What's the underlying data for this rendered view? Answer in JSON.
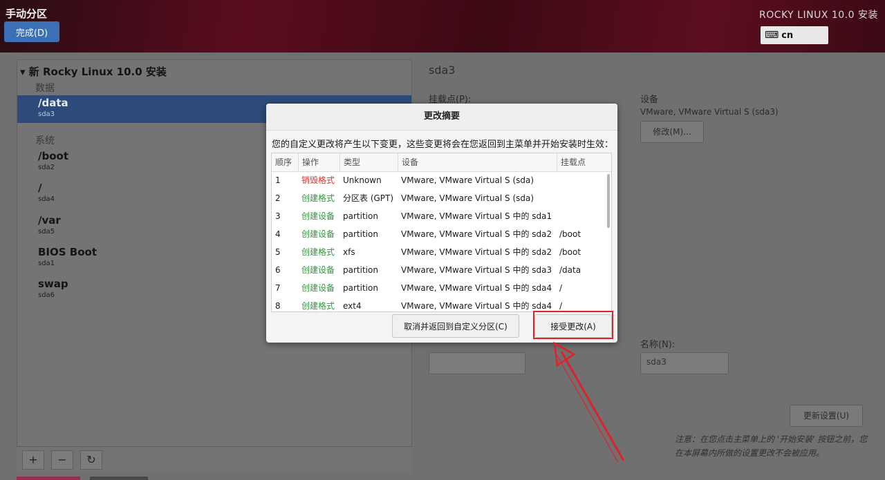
{
  "topbar": {
    "title": "手动分区",
    "done_label": "完成(D)",
    "product": "ROCKY LINUX 10.0 安装",
    "keyboard_layout": "cn"
  },
  "tree": {
    "header": "新 Rocky Linux 10.0 安装",
    "groups": [
      "数据",
      "系统"
    ],
    "partitions": [
      {
        "mount": "/data",
        "device": "sda3",
        "selected": true
      },
      {
        "mount": "/boot",
        "device": "sda2"
      },
      {
        "mount": "/",
        "device": "sda4"
      },
      {
        "mount": "/var",
        "device": "sda5"
      },
      {
        "mount": "BIOS Boot",
        "device": "sda1"
      },
      {
        "mount": "swap",
        "device": "sda6"
      }
    ],
    "tools": [
      "+",
      "−",
      "↻"
    ]
  },
  "details": {
    "title": "sda3",
    "mount_label": "挂载点(P):",
    "device_label": "设备",
    "device_value": "VMware, VMware Virtual S (sda3)",
    "modify_label": "修改(M)...",
    "name_label": "名称(N):",
    "name_value": "sda3",
    "update_label": "更新设置(U)",
    "note": "注意：在您点击主菜单上的 '开始安装' 按钮之前，您在本屏幕内所做的设置更改不会被应用。"
  },
  "dialog": {
    "title": "更改摘要",
    "description": "您的自定义更改将产生以下变更，这些变更将会在您返回到主菜单并开始安装时生效：",
    "columns": [
      "顺序",
      "操作",
      "类型",
      "设备",
      "挂载点"
    ],
    "rows": [
      {
        "order": "1",
        "action": "销毁格式",
        "action_color": "red",
        "type": "Unknown",
        "device": "VMware, VMware Virtual S (sda)",
        "mount": ""
      },
      {
        "order": "2",
        "action": "创建格式",
        "action_color": "green",
        "type": "分区表 (GPT)",
        "device": "VMware, VMware Virtual S (sda)",
        "mount": ""
      },
      {
        "order": "3",
        "action": "创建设备",
        "action_color": "green",
        "type": "partition",
        "device": "VMware, VMware Virtual S 中的 sda1",
        "mount": ""
      },
      {
        "order": "4",
        "action": "创建设备",
        "action_color": "green",
        "type": "partition",
        "device": "VMware, VMware Virtual S 中的 sda2",
        "mount": "/boot"
      },
      {
        "order": "5",
        "action": "创建格式",
        "action_color": "green",
        "type": "xfs",
        "device": "VMware, VMware Virtual S 中的 sda2",
        "mount": "/boot"
      },
      {
        "order": "6",
        "action": "创建设备",
        "action_color": "green",
        "type": "partition",
        "device": "VMware, VMware Virtual S 中的 sda3",
        "mount": "/data"
      },
      {
        "order": "7",
        "action": "创建设备",
        "action_color": "green",
        "type": "partition",
        "device": "VMware, VMware Virtual S 中的 sda4",
        "mount": "/"
      },
      {
        "order": "8",
        "action": "创建格式",
        "action_color": "green",
        "type": "ext4",
        "device": "VMware, VMware Virtual S 中的 sda4",
        "mount": "/"
      }
    ],
    "cancel_label": "取消并返回到自定义分区(C)",
    "accept_label": "接受更改(A)"
  },
  "colors": {
    "accent": "#3b6fb6",
    "destroy": "#e03030",
    "create": "#2e9a3a",
    "highlight": "#e0202a"
  }
}
